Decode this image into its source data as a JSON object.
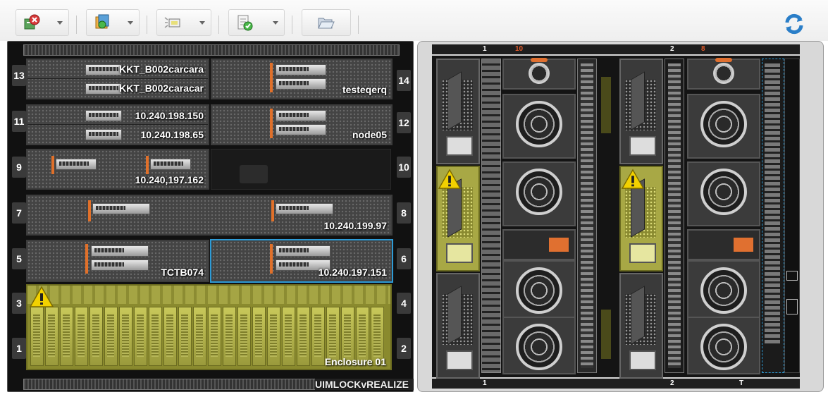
{
  "toolbar": {
    "buttons": [
      {
        "name": "status-actions",
        "icon": "server-error-icon"
      },
      {
        "name": "power-actions",
        "icon": "power-server-icon"
      },
      {
        "name": "identify-actions",
        "icon": "led-identify-icon"
      },
      {
        "name": "config-actions",
        "icon": "checklist-icon"
      },
      {
        "name": "folder-action",
        "icon": "folder-open-icon"
      }
    ],
    "refresh_icon": "refresh-icon"
  },
  "front_view": {
    "bottom_label": "UIMLOCKvREALIZE",
    "slots": {
      "s1": "1",
      "s2": "2",
      "s3": "3",
      "s4": "4",
      "s5": "5",
      "s6": "6",
      "s7": "7",
      "s8": "8",
      "s9": "9",
      "s10": "10",
      "s11": "11",
      "s12": "12",
      "s13": "13",
      "s14": "14"
    },
    "nodes": {
      "n13a": "KKT_B002carcara",
      "n13b": "KKT_B002caracar",
      "n14": "testeqerq",
      "n11a": "10.240.198.150",
      "n11b": "10.240.198.65",
      "n12": "node05",
      "n9": "10.240,197.162",
      "n7": "10.240.199.97",
      "n5": "TCTB074",
      "n6": "10.240.197.151",
      "storage": "Enclosure 01"
    }
  },
  "rear_view": {
    "top_bar": {
      "l1": "1",
      "l2": "10",
      "l3": "2",
      "l4": "8"
    },
    "bottom_bar": {
      "l1": "1",
      "l2": "2",
      "l3": "T"
    }
  },
  "colors": {
    "selected_outline": "#2e9bd6",
    "warning_yellow": "#f2d100",
    "handle_orange": "#e0702a"
  }
}
